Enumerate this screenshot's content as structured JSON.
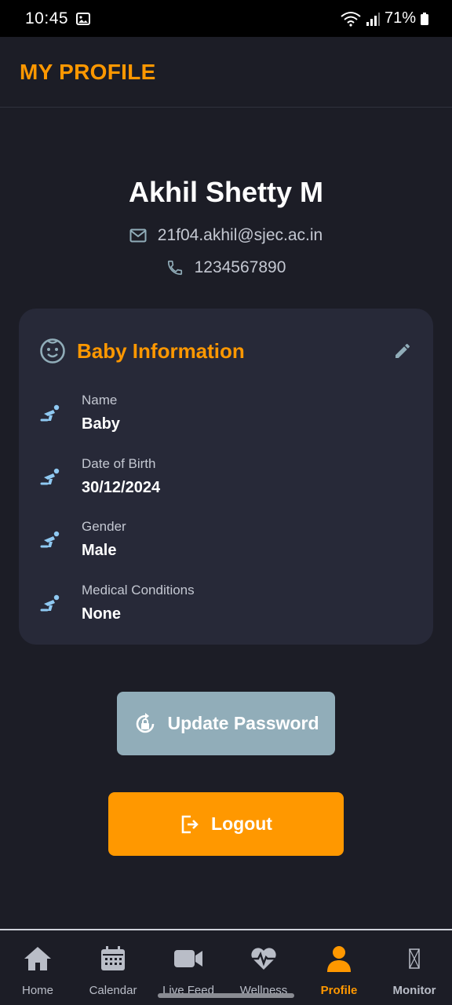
{
  "status_bar": {
    "time": "10:45",
    "battery": "71%"
  },
  "app_bar": {
    "title": "MY PROFILE"
  },
  "user": {
    "name": "Akhil Shetty M",
    "email": "21f04.akhil@sjec.ac.in",
    "phone": "1234567890"
  },
  "baby_card": {
    "title": "Baby Information",
    "fields": [
      {
        "label": "Name",
        "value": "Baby"
      },
      {
        "label": "Date of Birth",
        "value": "30/12/2024"
      },
      {
        "label": "Gender",
        "value": "Male"
      },
      {
        "label": "Medical Conditions",
        "value": "None"
      }
    ]
  },
  "actions": {
    "update_password": "Update Password",
    "logout": "Logout"
  },
  "nav": {
    "items": [
      {
        "label": "Home",
        "icon": "home-icon"
      },
      {
        "label": "Calendar",
        "icon": "calendar-icon"
      },
      {
        "label": "Live Feed",
        "icon": "video-camera-icon"
      },
      {
        "label": "Wellness",
        "icon": "heart-pulse-icon"
      },
      {
        "label": "Profile",
        "icon": "person-icon",
        "active": true
      },
      {
        "label": "Monitor",
        "icon": "monitor-icon"
      }
    ]
  },
  "colors": {
    "accent": "#ff9800",
    "background": "#1c1d26",
    "card": "#272938",
    "secondary_button": "#91adb9",
    "icon_blue": "#8fc9f2"
  }
}
